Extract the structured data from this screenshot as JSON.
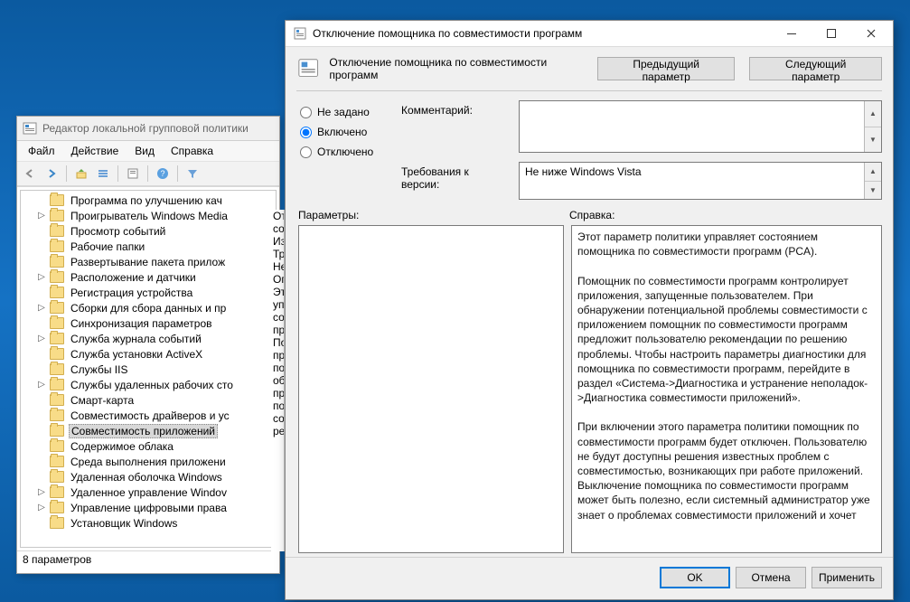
{
  "gpo": {
    "title": "Редактор локальной групповой политики",
    "menu": [
      "Файл",
      "Действие",
      "Вид",
      "Справка"
    ],
    "status": "8 параметров",
    "tree": [
      {
        "label": "Программа по улучшению кач",
        "exp": ""
      },
      {
        "label": "Проигрыватель Windows Media",
        "exp": ">"
      },
      {
        "label": "Просмотр событий",
        "exp": ""
      },
      {
        "label": "Рабочие папки",
        "exp": ""
      },
      {
        "label": "Развертывание пакета прилож",
        "exp": ""
      },
      {
        "label": "Расположение и датчики",
        "exp": ">"
      },
      {
        "label": "Регистрация устройства",
        "exp": ""
      },
      {
        "label": "Сборки для сбора данных и пр",
        "exp": ">"
      },
      {
        "label": "Синхронизация параметров",
        "exp": ""
      },
      {
        "label": "Служба журнала событий",
        "exp": ">"
      },
      {
        "label": "Служба установки ActiveX",
        "exp": ""
      },
      {
        "label": "Службы IIS",
        "exp": ""
      },
      {
        "label": "Службы удаленных рабочих сто",
        "exp": ">"
      },
      {
        "label": "Смарт-карта",
        "exp": ""
      },
      {
        "label": "Совместимость драйверов и ус",
        "exp": ""
      },
      {
        "label": "Совместимость приложений",
        "exp": "",
        "selected": true
      },
      {
        "label": "Содержимое облака",
        "exp": ""
      },
      {
        "label": "Среда выполнения приложени",
        "exp": ""
      },
      {
        "label": "Удаленная оболочка Windows",
        "exp": ""
      },
      {
        "label": "Удаленное управление Windov",
        "exp": ">"
      },
      {
        "label": "Управление цифровыми права",
        "exp": ">"
      },
      {
        "label": "Установщик Windows",
        "exp": ""
      }
    ]
  },
  "mid_fragments": [
    "От",
    "со",
    "",
    "Из",
    "",
    "Тр",
    "Не",
    "",
    "Оп",
    "Эт",
    "уп",
    "со",
    "пр",
    "",
    "По",
    "пр",
    "по",
    "об",
    "пр",
    "по",
    "со",
    "ре"
  ],
  "dlg": {
    "window_title": "Отключение помощника по совместимости программ",
    "policy_title": "Отключение помощника по совместимости программ",
    "nav_prev": "Предыдущий параметр",
    "nav_next": "Следующий параметр",
    "radio_not_set": "Не задано",
    "radio_on": "Включено",
    "radio_off": "Отключено",
    "selected_radio": "on",
    "comment_label": "Комментарий:",
    "comment_value": "",
    "req_label": "Требования к версии:",
    "req_value": "Не ниже Windows Vista",
    "params_label": "Параметры:",
    "help_label": "Справка:",
    "help_p1": "Этот параметр политики управляет состоянием помощника по совместимости программ (PCA).",
    "help_p2": "Помощник по совместимости программ контролирует приложения, запущенные пользователем. При обнаружении потенциальной проблемы совместимости с приложением помощник по совместимости программ предложит пользователю рекомендации по решению проблемы. Чтобы настроить параметры диагностики для помощника по совместимости программ, перейдите в раздел «Система->Диагностика и устранение неполадок->Диагностика совместимости приложений».",
    "help_p3": "При включении этого параметра политики помощник по совместимости программ будет отключен. Пользователю не будут доступны решения известных проблем с совместимостью, возникающих при работе приложений. Выключение помощника по совместимости программ может быть полезно, если системный администратор уже знает о проблемах совместимости приложений и хочет",
    "btn_ok": "OK",
    "btn_cancel": "Отмена",
    "btn_apply": "Применить"
  }
}
